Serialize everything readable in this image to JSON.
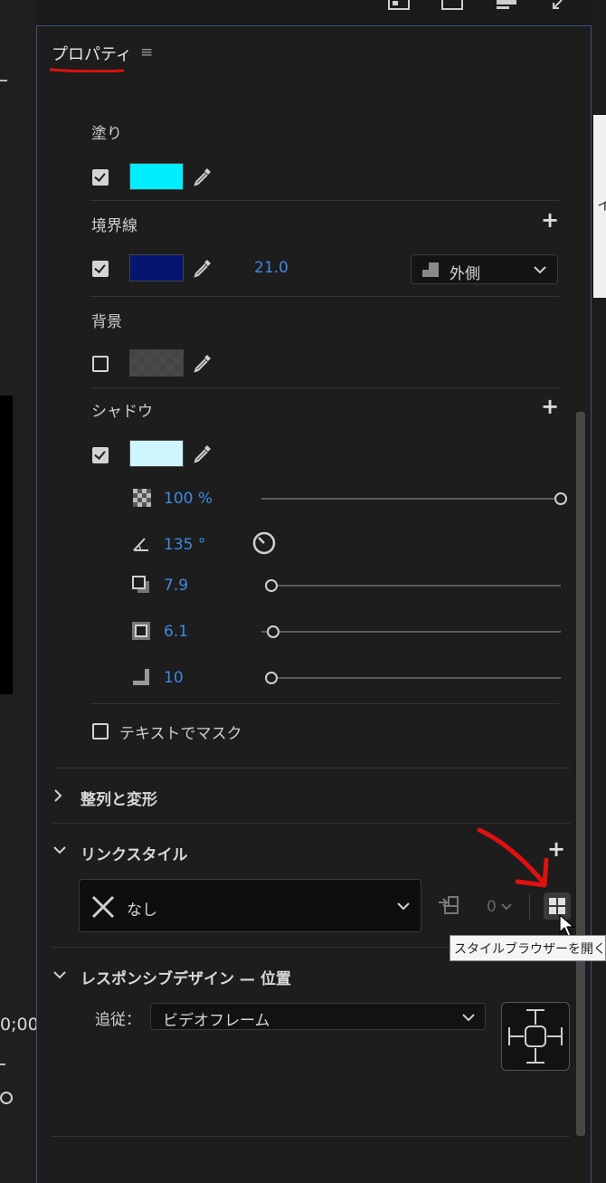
{
  "left": {
    "timecode": "0;00"
  },
  "panel": {
    "title": "プロパティ",
    "menu_icon": "hamburger-icon"
  },
  "fill": {
    "label": "塗り",
    "enabled": true,
    "color": "#00eeff"
  },
  "stroke": {
    "label": "境界線",
    "enabled": true,
    "color": "#061570",
    "width": "21.0",
    "position": "外側"
  },
  "background": {
    "label": "背景",
    "enabled": false,
    "color": "#444444"
  },
  "shadow": {
    "label": "シャドウ",
    "enabled": true,
    "color": "#cff6ff",
    "opacity": "100 %",
    "opacity_value": 100,
    "angle": "135 °",
    "distance": "7.9",
    "distance_value": 0,
    "size": "6.1",
    "size_value": 0.04,
    "blur": "10",
    "blur_value": 0
  },
  "text_mask": {
    "label": "テキストでマスク",
    "enabled": false
  },
  "align_section": {
    "label": "整列と変形"
  },
  "linked_style": {
    "label": "リンクスタイル",
    "selected": "なし",
    "count": "0"
  },
  "tooltip": {
    "text": "スタイルブラウザーを開く"
  },
  "responsive": {
    "label": "レスポンシブデザイン — 位置",
    "follow_label": "追従：",
    "follow_value": "ビデオフレーム"
  },
  "colors": {
    "accent_blue": "#3f8ae0",
    "annotation_red": "#e01010"
  }
}
